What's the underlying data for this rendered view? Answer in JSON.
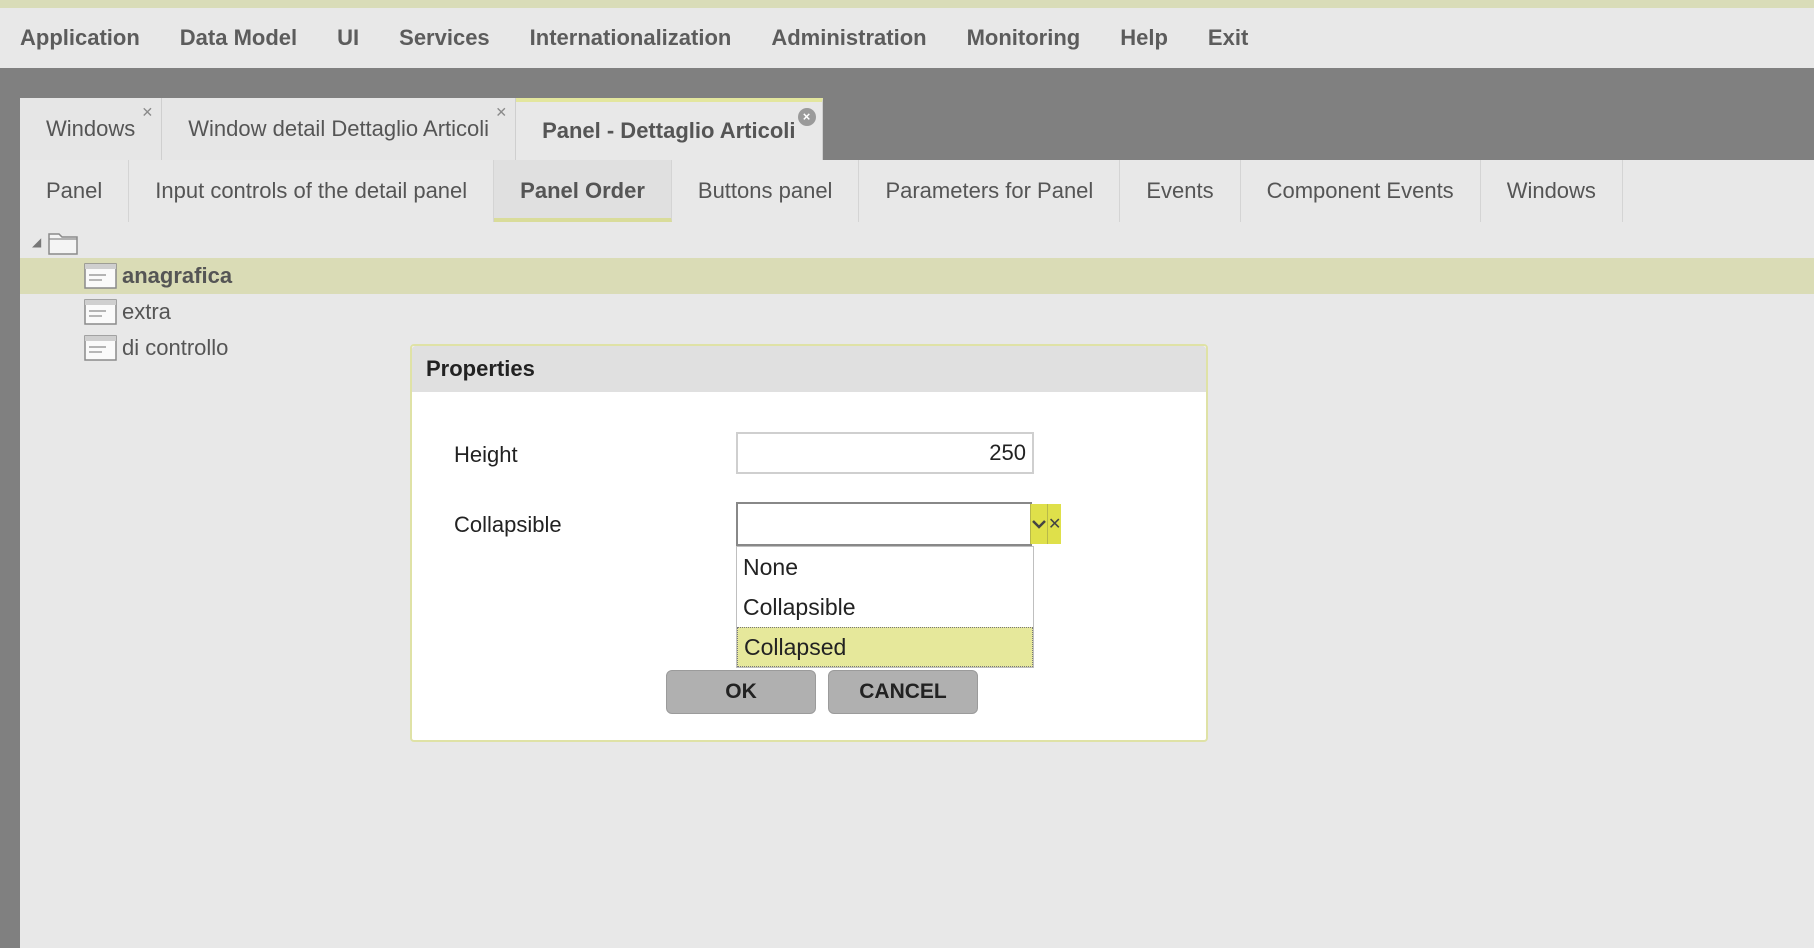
{
  "menu": [
    "Application",
    "Data Model",
    "UI",
    "Services",
    "Internationalization",
    "Administration",
    "Monitoring",
    "Help",
    "Exit"
  ],
  "top_tabs": [
    {
      "label": "Windows"
    },
    {
      "label": "Window detail Dettaglio Articoli"
    },
    {
      "label": "Panel - Dettaglio Articoli"
    }
  ],
  "sub_tabs": [
    "Panel",
    "Input controls of the detail panel",
    "Panel Order",
    "Buttons panel",
    "Parameters for Panel",
    "Events",
    "Component Events",
    "Windows"
  ],
  "tree": {
    "items": [
      "anagrafica",
      "extra",
      "di controllo"
    ],
    "selected": "anagrafica"
  },
  "dialog": {
    "title": "Properties",
    "height_label": "Height",
    "height_value": "250",
    "collapsible_label": "Collapsible",
    "collapsible_value": "",
    "options": [
      "None",
      "Collapsible",
      "Collapsed"
    ],
    "highlighted_option": "Collapsed",
    "ok_label": "OK",
    "cancel_label": "CANCEL"
  },
  "colors": {
    "accent": "#dfe04a",
    "selection": "#dadcb6",
    "background": "#808080"
  }
}
